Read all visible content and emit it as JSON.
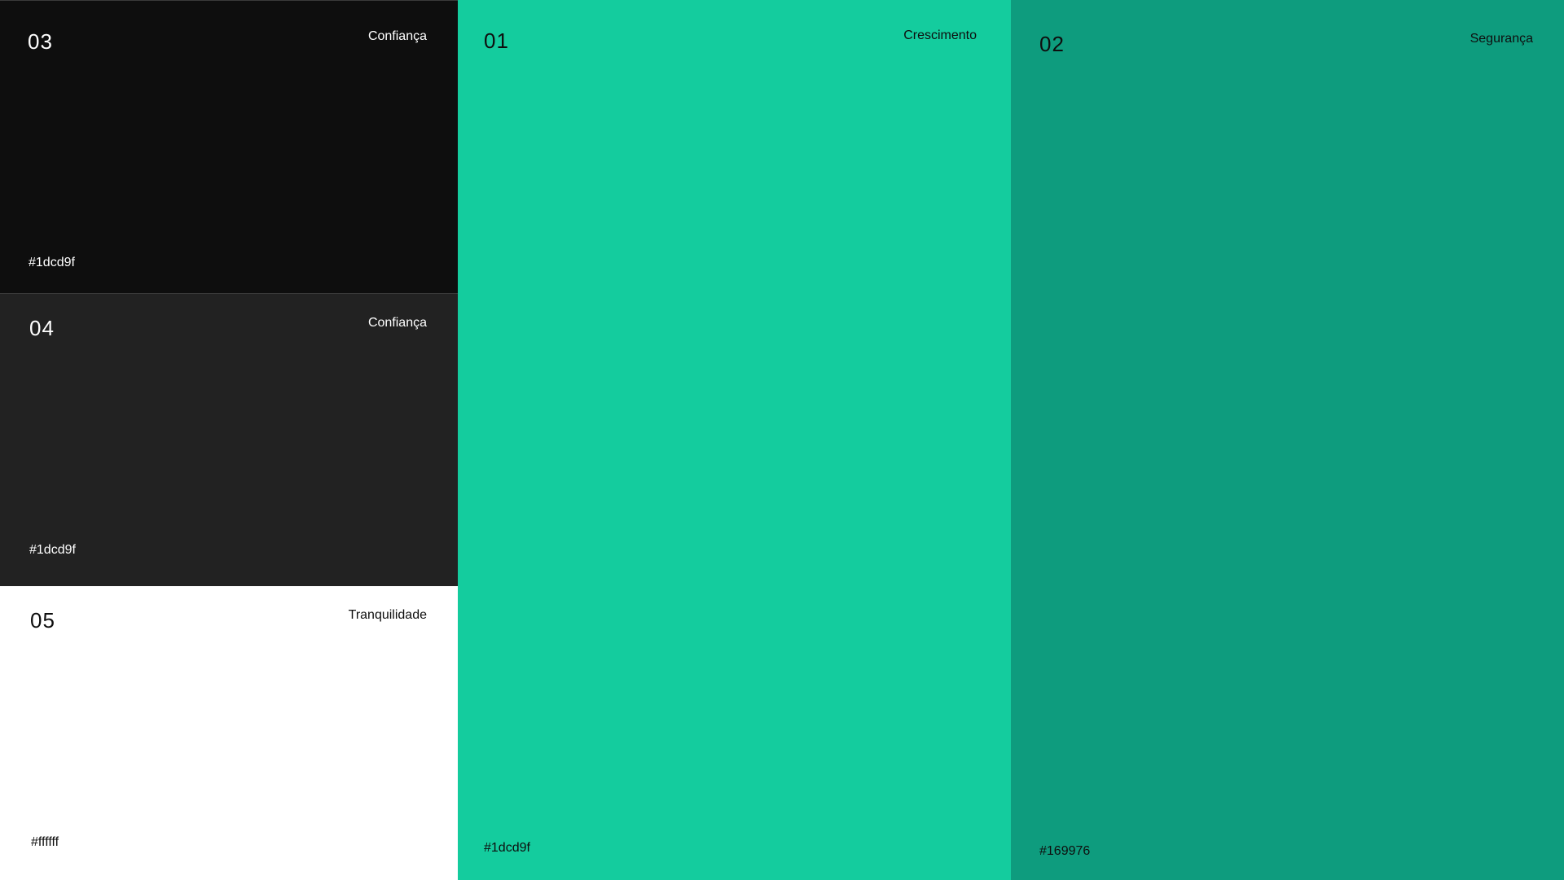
{
  "swatches": {
    "s03": {
      "number": "03",
      "name": "Confiança",
      "hex_label": "#1dcd9f",
      "background": "#0e0e0e",
      "text_color": "#ffffff"
    },
    "s04": {
      "number": "04",
      "name": "Confiança",
      "hex_label": "#1dcd9f",
      "background": "#222222",
      "text_color": "#ffffff"
    },
    "s05": {
      "number": "05",
      "name": "Tranquilidade",
      "hex_label": "#ffffff",
      "background": "#ffffff",
      "text_color": "#0e0e0e"
    },
    "s01": {
      "number": "01",
      "name": "Crescimento",
      "hex_label": "#1dcd9f",
      "background": "#14cc9e",
      "text_color": "#0e0e0e"
    },
    "s02": {
      "number": "02",
      "name": "Segurança",
      "hex_label": "#169976",
      "background": "#0e9c7e",
      "text_color": "#0e0e0e"
    }
  }
}
